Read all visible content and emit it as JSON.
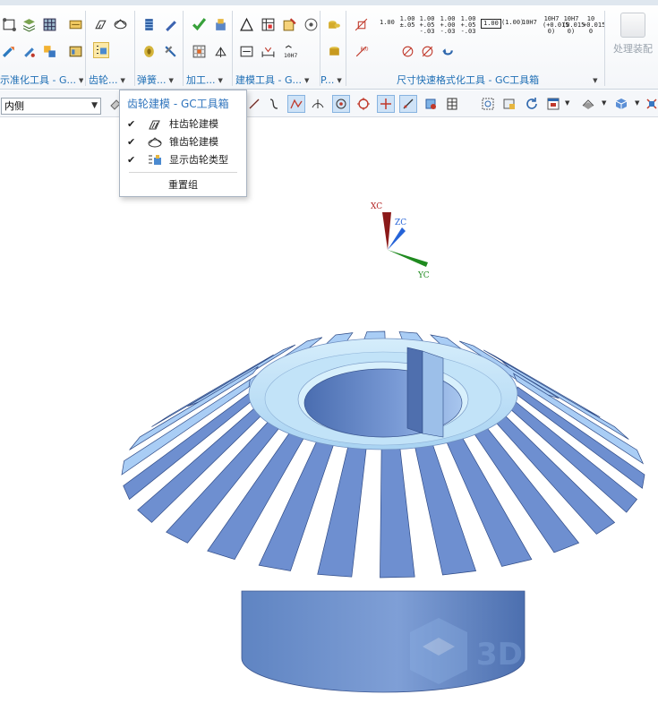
{
  "ribbon": {
    "groups": [
      {
        "label": "示准化工具 - G...",
        "icons": [
          "datum-plane-icon",
          "layers-icon",
          "grid-icon",
          "pencil-icon",
          "transform-icon",
          "rotate-icon",
          "move-icon",
          "table-icon"
        ]
      },
      {
        "label": "齿轮...",
        "icons": [
          "cylindrical-gear-icon",
          "bevel-gear-icon",
          "gear-type-icon"
        ]
      },
      {
        "label": "弹簧...",
        "icons": [
          "spring-icon",
          "pencil-blue-icon",
          "spring-end-icon",
          "tool-icon"
        ]
      },
      {
        "label": "加工...",
        "icons": [
          "check-icon",
          "clamp-icon",
          "drill-icon",
          "fixture-icon"
        ]
      },
      {
        "label": "建模工具 - G...",
        "icons": [
          "triangle-icon",
          "sheet-table-icon",
          "hole-table-icon",
          "cube-icon",
          "shape-icon",
          "dimension-icon",
          "tolerance-10h7-icon"
        ]
      },
      {
        "label": "P...",
        "icons": [
          "cylinders-icon",
          "cylinders-alt-icon"
        ]
      },
      {
        "label": "尺寸快速格式化工具 - GC工具箱",
        "icons": [
          "basic-dim-icon",
          "tol-icon",
          "chain-dim-icon",
          "no-entry-icon",
          "circle-diameter-icon",
          "undo-arrow-icon"
        ]
      }
    ],
    "tolerance_labels": [
      "1.00",
      "1.00 +.05",
      "1.00 +.05 -.03",
      "1.00 +.00 -.03",
      "1.00 +.05 -.03",
      "1.00",
      "(1.00)",
      "10H7",
      "10H7 (+0.015 0)",
      "10H7 (0.015 0)",
      "10 (+0.015 0)"
    ],
    "assembly_label": "处理装配"
  },
  "toolbar2": {
    "selection_value": "内侧",
    "icons": [
      "eraser-icon",
      "line-icon",
      "curve-icon",
      "polyline-icon",
      "perpendicular-icon",
      "point-on-curve-icon",
      "circle-snap-icon",
      "cross-icon",
      "slash-line-icon",
      "shape-icon",
      "grid-table-icon",
      "zoom-fit-icon",
      "view-icon",
      "refresh-icon",
      "view-orient-icon",
      "shading-icon",
      "cube-view-icon",
      "section-icon"
    ]
  },
  "popup": {
    "title": "齿轮建模 - GC工具箱",
    "items": [
      {
        "label": "柱齿轮建模",
        "checked": "✔",
        "icon": "spur-gear-icon"
      },
      {
        "label": "锥齿轮建模",
        "checked": "✔",
        "icon": "bevel-gear-icon"
      },
      {
        "label": "显示齿轮类型",
        "checked": "✔",
        "icon": "gear-type-list-icon"
      }
    ],
    "reset_label": "重置组"
  },
  "viewport": {
    "axes": {
      "x": "XC",
      "y": "YC",
      "z": "ZC"
    },
    "model": "bevel-gear",
    "tooth_count": 26,
    "watermark": "3D"
  }
}
